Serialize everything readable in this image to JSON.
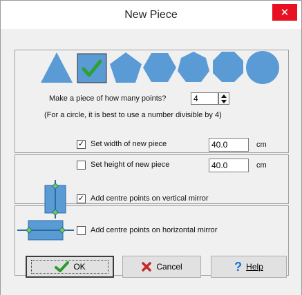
{
  "window": {
    "title": "New Piece",
    "close_icon": "close-icon"
  },
  "shapes": {
    "fill_color": "#5b9bd5",
    "selected_color": "#2ea12e",
    "items": [
      "triangle",
      "square",
      "pentagon",
      "hexagon",
      "heptagon",
      "octagon",
      "circle"
    ],
    "selected": "square"
  },
  "points": {
    "label": "Make a piece of how many points?",
    "value": "4",
    "hint": "(For a circle, it is best to use a number divisible by 4)"
  },
  "width": {
    "label": "Set width of new piece",
    "checked": true,
    "value": "40.0",
    "unit": "cm"
  },
  "height": {
    "label": "Set height of new piece",
    "checked": false,
    "value": "40.0",
    "unit": "cm"
  },
  "mirror": {
    "vertical_label": "Add centre points on vertical mirror",
    "vertical_checked": true,
    "horizontal_label": "Add centre points on horizontal mirror",
    "horizontal_checked": false
  },
  "buttons": {
    "ok": "OK",
    "cancel": "Cancel",
    "help": "Help"
  }
}
